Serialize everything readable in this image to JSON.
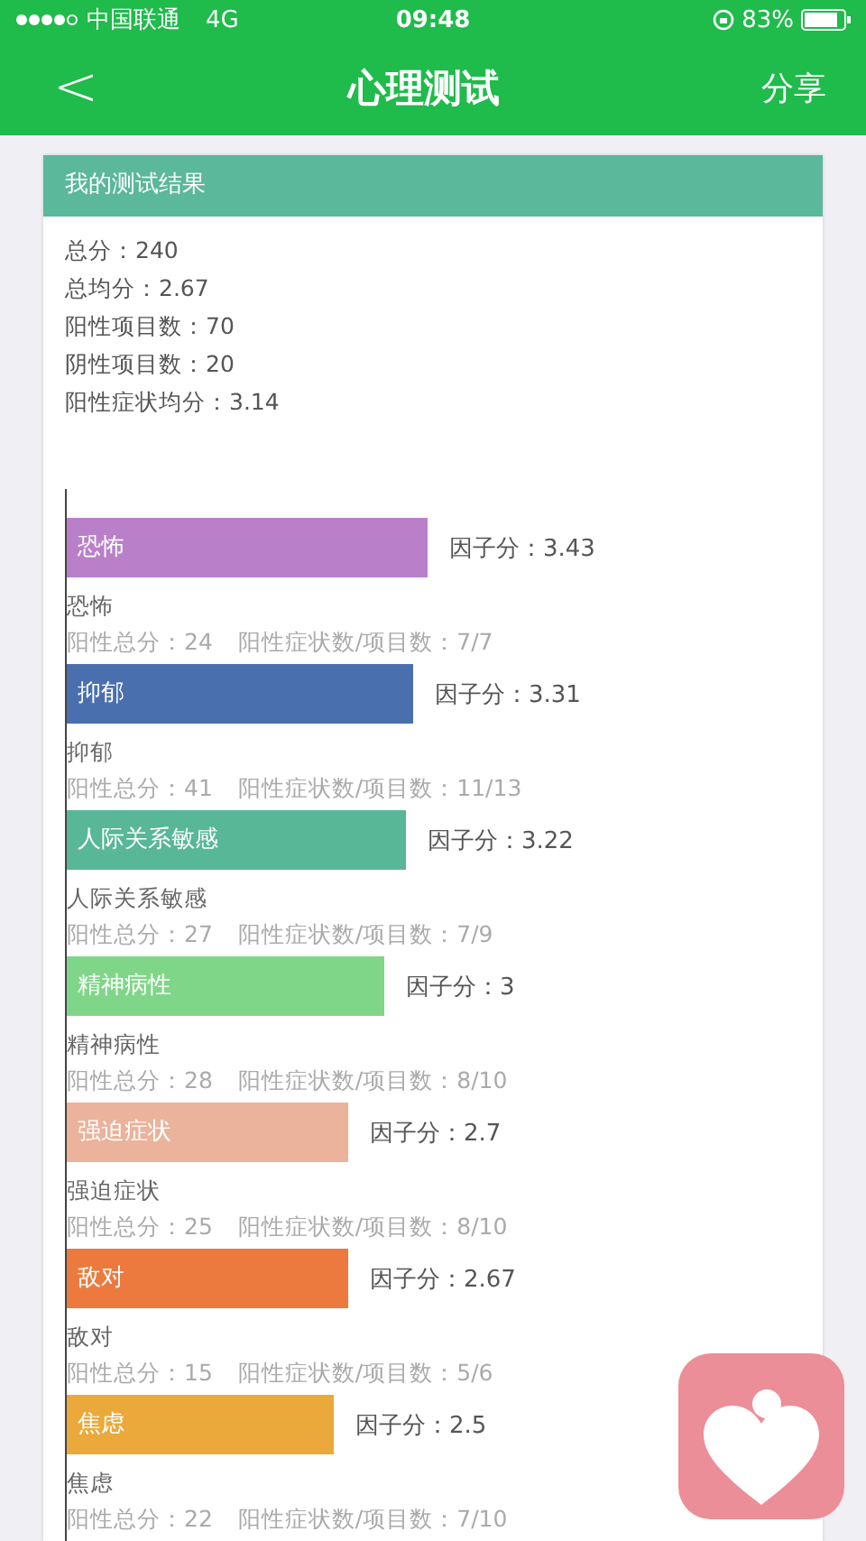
{
  "status_bar": {
    "carrier": "中国联通",
    "network": "4G",
    "time": "09:48",
    "battery": "83%"
  },
  "nav": {
    "back": "<",
    "title": "心理测试",
    "action": "分享"
  },
  "result": {
    "title": "我的测试结果",
    "stats": [
      "总分：240",
      "总均分：2.67",
      "阳性项目数：70",
      "阴性项目数：20",
      "阳性症状均分：3.14"
    ],
    "factors": [
      {
        "bar_label": "恐怖",
        "color": "#b97fc9",
        "level": 0.5,
        "score": "因子分：3.43",
        "name": "恐怖",
        "positive_total": "阳性总分：24",
        "ratio": "阳性症状数/项目数：7/7"
      },
      {
        "bar_label": "抑郁",
        "color": "#4a6fae",
        "level": 0.48,
        "score": "因子分：3.31",
        "name": "抑郁",
        "positive_total": "阳性总分：41",
        "ratio": "阳性症状数/项目数：11/13"
      },
      {
        "bar_label": "人际关系敏感",
        "color": "#58b796",
        "level": 0.47,
        "score": "因子分：3.22",
        "name": "人际关系敏感",
        "positive_total": "阳性总分：27",
        "ratio": "阳性症状数/项目数：7/9"
      },
      {
        "bar_label": "精神病性",
        "color": "#80d688",
        "level": 0.44,
        "score": "因子分：3",
        "name": "精神病性",
        "positive_total": "阳性总分：28",
        "ratio": "阳性症状数/项目数：8/10"
      },
      {
        "bar_label": "强迫症状",
        "color": "#ebb39b",
        "level": 0.39,
        "score": "因子分：2.7",
        "name": "强迫症状",
        "positive_total": "阳性总分：25",
        "ratio": "阳性症状数/项目数：8/10"
      },
      {
        "bar_label": "敌对",
        "color": "#ec7a3f",
        "level": 0.39,
        "score": "因子分：2.67",
        "name": "敌对",
        "positive_total": "阳性总分：15",
        "ratio": "阳性症状数/项目数：5/6"
      },
      {
        "bar_label": "焦虑",
        "color": "#eaa93a",
        "level": 0.37,
        "score": "因子分：2.5",
        "name": "焦虑",
        "positive_total": "阳性总分：22",
        "ratio": "阳性症状数/项目数：7/10"
      }
    ]
  }
}
